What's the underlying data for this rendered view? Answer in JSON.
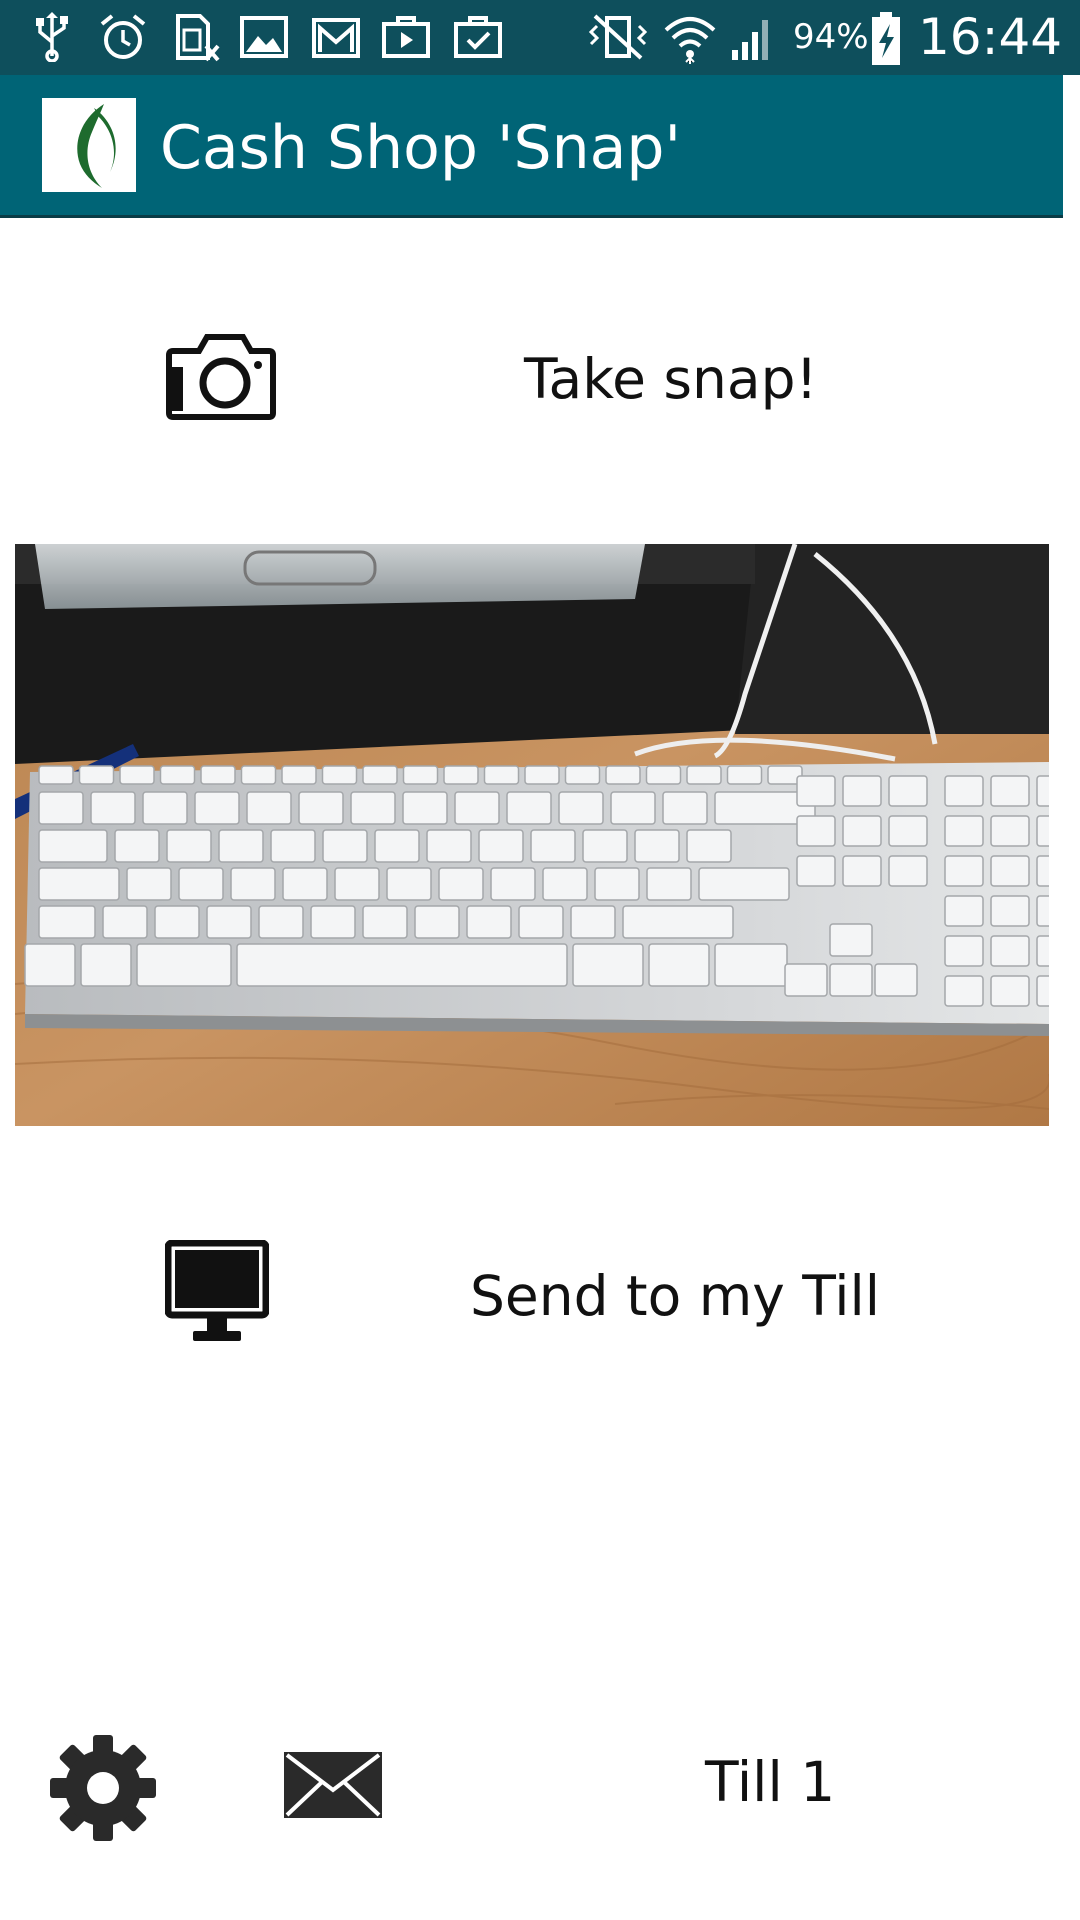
{
  "status_bar": {
    "battery_percent": "94%",
    "time": "16:44",
    "icons": [
      "usb-icon",
      "alarm-icon",
      "sim-card-icon",
      "gallery-icon",
      "gmail-icon",
      "briefcase-play-icon",
      "briefcase-check-icon",
      "vibrate-mute-icon",
      "wifi-icon",
      "signal-icon",
      "battery-charging-icon"
    ]
  },
  "app_bar": {
    "title": "Cash Shop 'Snap'",
    "logo_colors": [
      "#1e6b2e",
      "#ffffff"
    ],
    "background": "#006476"
  },
  "main": {
    "take_snap_label": "Take snap!",
    "take_snap_icon": "camera-icon",
    "photo": {
      "subject": "keyboard-photo"
    },
    "send_label": "Send to my Till",
    "send_icon": "monitor-icon"
  },
  "bottom_bar": {
    "settings_icon": "gear-icon",
    "mail_icon": "envelope-icon",
    "till_label": "Till 1"
  }
}
